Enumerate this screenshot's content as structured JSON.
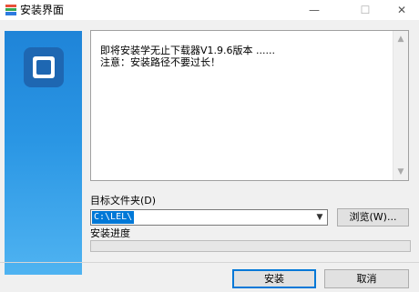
{
  "window": {
    "title": "安装界面",
    "minimize_glyph": "—",
    "maximize_glyph": "☐",
    "close_glyph": "✕"
  },
  "memo": {
    "lines": [
      "即将安装学无止下载器V1.9.6版本 ......",
      "注意：安装路径不要过长！"
    ]
  },
  "target": {
    "label": "目标文件夹(D)",
    "path": "C:\\LEL\\",
    "browse_label": "浏览(W)..."
  },
  "progress": {
    "label": "安装进度",
    "value": 0
  },
  "buttons": {
    "install": "安装",
    "cancel": "取消"
  },
  "colors": {
    "accent": "#0078d7",
    "sidebar_top": "#1f84d8",
    "sidebar_bottom": "#4fb3f1",
    "logo": "#1e67b2"
  },
  "icons": {
    "app": "colorful-stack-icon",
    "sidebar_logo": "square-logo-icon"
  }
}
